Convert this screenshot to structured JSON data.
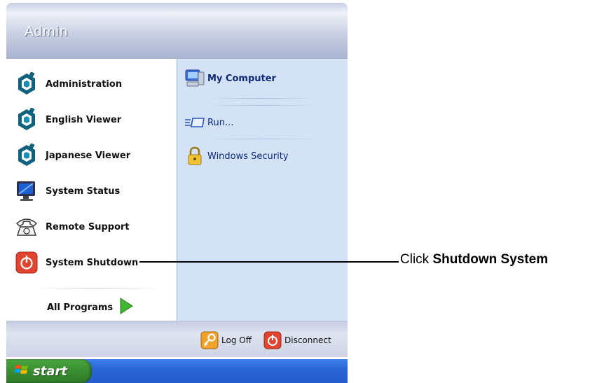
{
  "start_menu": {
    "user_name": "Admin",
    "left_items": [
      {
        "label": "Administration",
        "icon": "hexagon-app-icon"
      },
      {
        "label": "English Viewer",
        "icon": "hexagon-app-icon"
      },
      {
        "label": "Japanese Viewer",
        "icon": "hexagon-app-icon"
      },
      {
        "label": "System Status",
        "icon": "monitor-icon"
      },
      {
        "label": "Remote Support",
        "icon": "telephone-icon"
      },
      {
        "label": "System Shutdown",
        "icon": "power-icon"
      }
    ],
    "all_programs": {
      "label": "All Programs",
      "icon": "green-arrow-icon"
    },
    "right_items": [
      {
        "label": "My Computer",
        "icon": "my-computer-icon"
      },
      {
        "label": "Run...",
        "icon": "run-icon"
      },
      {
        "label": "Windows Security",
        "icon": "padlock-icon"
      }
    ],
    "footer": {
      "log_off": "Log Off",
      "disconnect": "Disconnect"
    }
  },
  "taskbar": {
    "start_label": "start"
  },
  "callout": {
    "prefix": "Click ",
    "emphasis": "Shutdown System"
  },
  "colors": {
    "taskbar_blue": "#245bcd",
    "start_green": "#3b8f33",
    "power_red": "#e0452f",
    "link_blue": "#0e2a78"
  }
}
